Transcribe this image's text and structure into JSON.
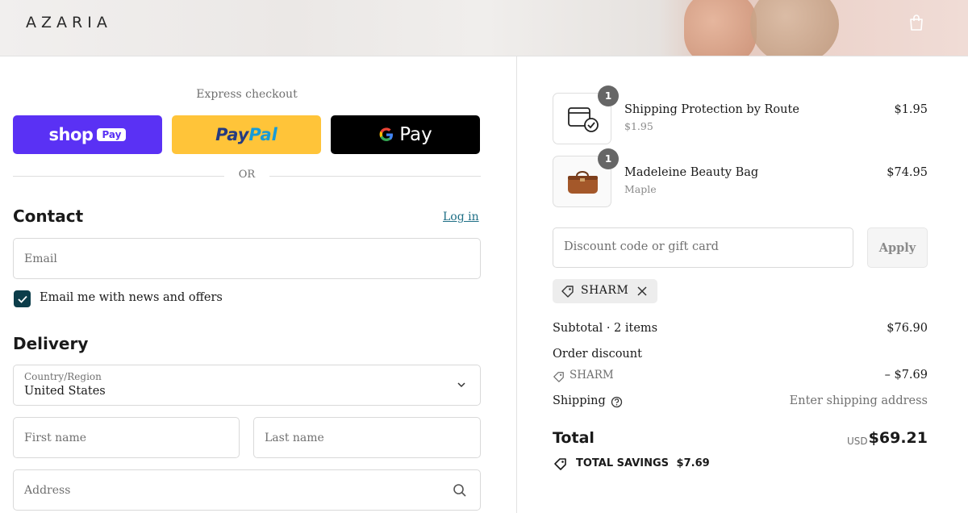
{
  "header": {
    "logo": "AZARIA",
    "cart_icon": "shopping-bag-icon"
  },
  "express": {
    "title": "Express checkout",
    "shop_pay": {
      "word": "shop",
      "box": "Pay"
    },
    "paypal": {
      "pay": "Pay",
      "pal": "Pal"
    },
    "gpay": {
      "g": "G",
      "text": "Pay"
    },
    "or": "OR"
  },
  "contact": {
    "title": "Contact",
    "login": "Log in",
    "email_placeholder": "Email",
    "newsletter_label": "Email me with news and offers",
    "newsletter_checked": true
  },
  "delivery": {
    "title": "Delivery",
    "country_label": "Country/Region",
    "country_value": "United States",
    "first_name_placeholder": "First name",
    "last_name_placeholder": "Last name",
    "address_placeholder": "Address"
  },
  "order": {
    "items": [
      {
        "name": "Shipping Protection by Route",
        "sub": "$1.95",
        "price": "$1.95",
        "qty": "1",
        "icon": "shipping-protection-icon"
      },
      {
        "name": "Madeleine Beauty Bag",
        "sub": "Maple",
        "price": "$74.95",
        "qty": "1",
        "icon": "beauty-bag-image"
      }
    ],
    "discount_placeholder": "Discount code or gift card",
    "apply_label": "Apply",
    "applied_code": "SHARM",
    "subtotal_label": "Subtotal · 2 items",
    "subtotal_value": "$76.90",
    "order_discount_label": "Order discount",
    "order_discount_code": "SHARM",
    "order_discount_value": "– $7.69",
    "shipping_label": "Shipping",
    "shipping_value": "Enter shipping address",
    "total_label": "Total",
    "currency": "USD",
    "total_value": "$69.21",
    "savings_label": "TOTAL SAVINGS",
    "savings_value": "$7.69"
  },
  "colors": {
    "shop_pay": "#5a31f4",
    "paypal": "#ffc439",
    "gpay": "#000000",
    "accent_link": "#1f6f86",
    "checkbox": "#0c3d4a"
  }
}
